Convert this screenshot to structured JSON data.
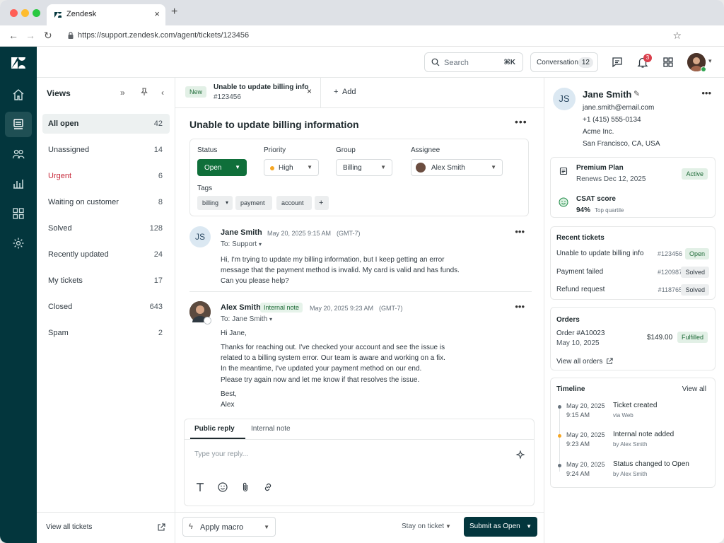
{
  "browser": {
    "tab_title": "Zendesk",
    "new_tab": "+",
    "url": "https://support.zendesk.com/agent/tickets/123456"
  },
  "topbar": {
    "search_placeholder": "Search",
    "search_shortcut": "⌘K",
    "conversations_label": "Conversations",
    "conversations_count": "12",
    "notifications_count": "3"
  },
  "views": {
    "title": "Views",
    "items": [
      {
        "label": "All open",
        "count": "42"
      },
      {
        "label": "Unassigned",
        "count": "14"
      },
      {
        "label": "Urgent",
        "count": "6"
      },
      {
        "label": "Waiting on customer",
        "count": "8"
      },
      {
        "label": "Solved",
        "count": "128"
      },
      {
        "label": "Recently updated",
        "count": "24"
      },
      {
        "label": "My tickets",
        "count": "17"
      },
      {
        "label": "Closed",
        "count": "643"
      },
      {
        "label": "Spam",
        "count": "2"
      }
    ],
    "footer_link": "View all tickets"
  },
  "ticket_tab": {
    "badge": "New",
    "title": "Unable to update billing info",
    "id": "#123456",
    "add_label": "Add"
  },
  "ticket": {
    "subject": "Unable to update billing information",
    "props": {
      "status_label": "Status",
      "status_value": "Open",
      "priority_label": "Priority",
      "priority_value": "High",
      "group_label": "Group",
      "group_value": "Billing",
      "assignee_label": "Assignee",
      "assignee_value": "Alex Smith",
      "tags_label": "Tags",
      "tags": [
        "billing",
        "payment",
        "account"
      ],
      "add_tag": "+"
    }
  },
  "messages": [
    {
      "initials": "JS",
      "name": "Jane Smith",
      "time": "May 20, 2025 9:15 AM",
      "tz": "(GMT-7)",
      "to": "To: Support",
      "lines": [
        "Hi, I'm trying to update my billing information, but I keep getting an error",
        "message that the payment method is invalid. My card is valid and has funds.",
        "Can you please help?"
      ]
    },
    {
      "name": "Alex Smith",
      "badge": "Internal note",
      "time": "May 20, 2025 9:23 AM",
      "tz": "(GMT-7)",
      "to": "To: Jane Smith",
      "lines": [
        "Hi Jane,",
        "Thanks for reaching out. I've checked your account and see the issue is",
        "related to a billing system error. Our team is aware and working on a fix.",
        "In the meantime, I've updated your payment method on our end.",
        "Please try again now and let me know if that resolves the issue.",
        "Best,",
        "Alex"
      ]
    }
  ],
  "reply": {
    "tab_public": "Public reply",
    "tab_internal": "Internal note",
    "placeholder": "Type your reply..."
  },
  "footer": {
    "macro": "Apply macro",
    "stay": "Stay on ticket",
    "submit": "Submit as Open"
  },
  "customer": {
    "initials": "JS",
    "name": "Jane Smith",
    "email": "jane.smith@email.com",
    "phone": "+1 (415) 555-0134",
    "company": "Acme Inc.",
    "location": "San Francisco, CA, USA",
    "plan_title": "Premium Plan",
    "plan_renews": "Renews Dec 12, 2025",
    "plan_status": "Active",
    "csat_title": "CSAT score",
    "csat_value": "94%",
    "csat_note": "Top quartile"
  },
  "recent_tickets": {
    "title": "Recent tickets",
    "items": [
      {
        "title": "Unable to update billing info",
        "id": "#123456",
        "status": "Open"
      },
      {
        "title": "Payment failed",
        "id": "#120987",
        "status": "Solved"
      },
      {
        "title": "Refund request",
        "id": "#118765",
        "status": "Solved"
      }
    ]
  },
  "orders": {
    "title": "Orders",
    "order_id": "Order #A10023",
    "date": "May 10, 2025",
    "amount": "$149.00",
    "status": "Fulfilled",
    "link": "View all orders"
  },
  "timeline": {
    "title": "Timeline",
    "view_all": "View all",
    "events": [
      {
        "date": "May 20, 2025",
        "time": "9:15 AM",
        "event": "Ticket created",
        "sub": "via Web"
      },
      {
        "date": "May 20, 2025",
        "time": "9:23 AM",
        "event": "Internal note added",
        "sub": "by Alex Smith"
      },
      {
        "date": "May 20, 2025",
        "time": "9:24 AM",
        "event": "Status changed to Open",
        "sub": "by Alex Smith"
      }
    ]
  }
}
